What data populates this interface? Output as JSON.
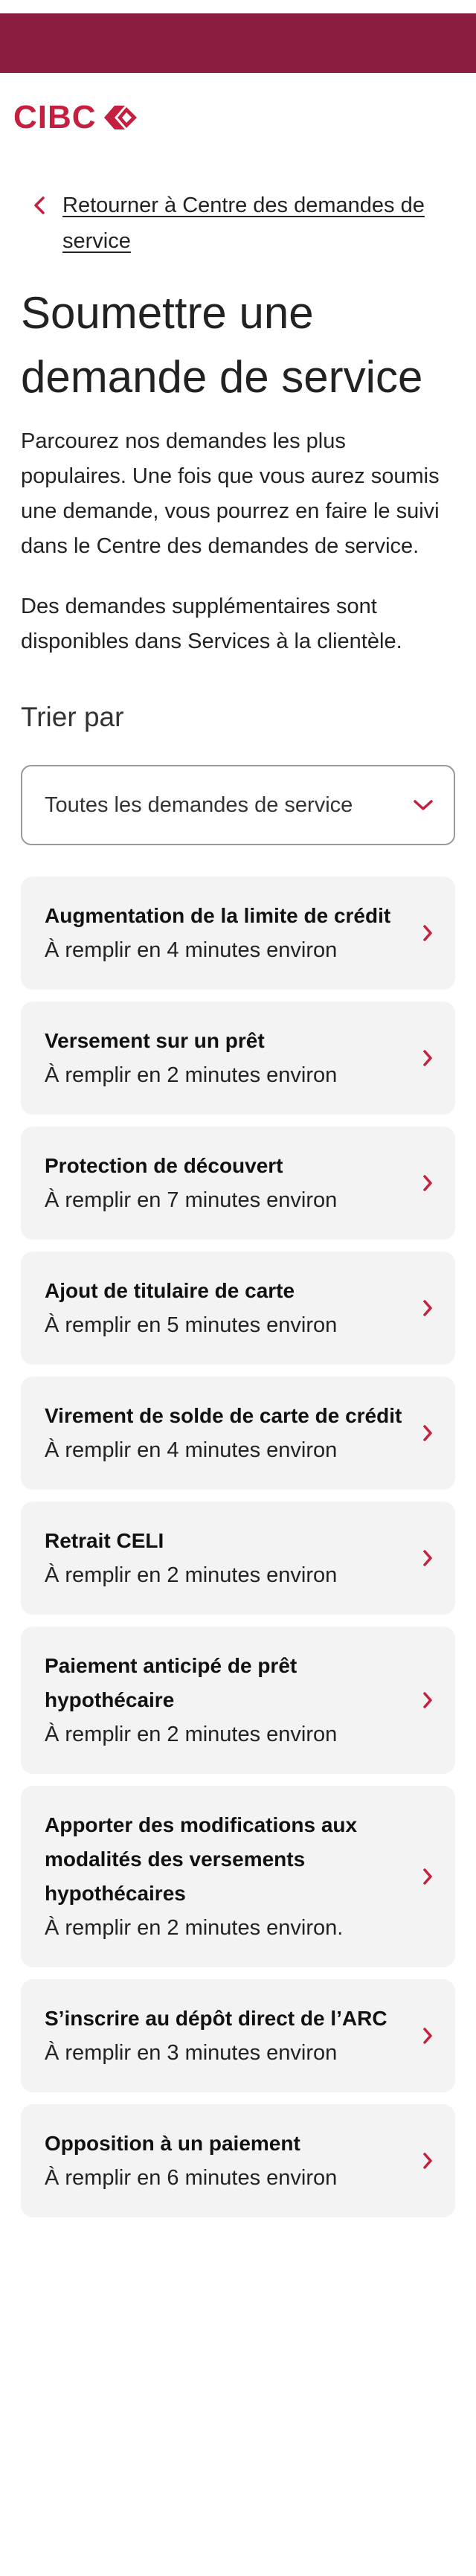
{
  "brand": {
    "logo_text": "CIBC",
    "bar_color": "#8b1d41",
    "accent_color": "#c41f3e"
  },
  "back_link": {
    "icon": "chevron-left-icon",
    "label": "Retourner à Centre des demandes de service"
  },
  "page_title": "Soumettre une demande de service",
  "intro": {
    "paragraph1": "Parcourez nos demandes les plus populaires. Une fois que vous aurez soumis une demande, vous pourrez en faire le suivi dans le Centre des demandes de service.",
    "paragraph2": "Des demandes supplémentaires sont disponibles dans Services à la clientèle."
  },
  "sort": {
    "label": "Trier par",
    "selected": "Toutes les demandes de service",
    "icon": "chevron-down-icon"
  },
  "requests": [
    {
      "title": "Augmentation de la limite de crédit",
      "time": "À remplir en 4 minutes environ"
    },
    {
      "title": "Versement sur un prêt",
      "time": "À remplir en 2 minutes environ"
    },
    {
      "title": "Protection de découvert",
      "time": "À remplir en 7 minutes environ"
    },
    {
      "title": "Ajout de titulaire de carte",
      "time": "À remplir en 5 minutes environ"
    },
    {
      "title": "Virement de solde de carte de crédit",
      "time": "À remplir en 4 minutes environ"
    },
    {
      "title": "Retrait CELI",
      "time": "À remplir en 2 minutes environ"
    },
    {
      "title": "Paiement anticipé de prêt hypothécaire",
      "time": "À remplir en 2 minutes environ"
    },
    {
      "title": "Apporter des modifications aux modalités des versements hypothécaires",
      "time": "À remplir en 2 minutes environ."
    },
    {
      "title": "S’inscrire au dépôt direct de l’ARC",
      "time": "À remplir en 3 minutes environ"
    },
    {
      "title": "Opposition à un paiement",
      "time": "À remplir en 6 minutes environ"
    }
  ]
}
